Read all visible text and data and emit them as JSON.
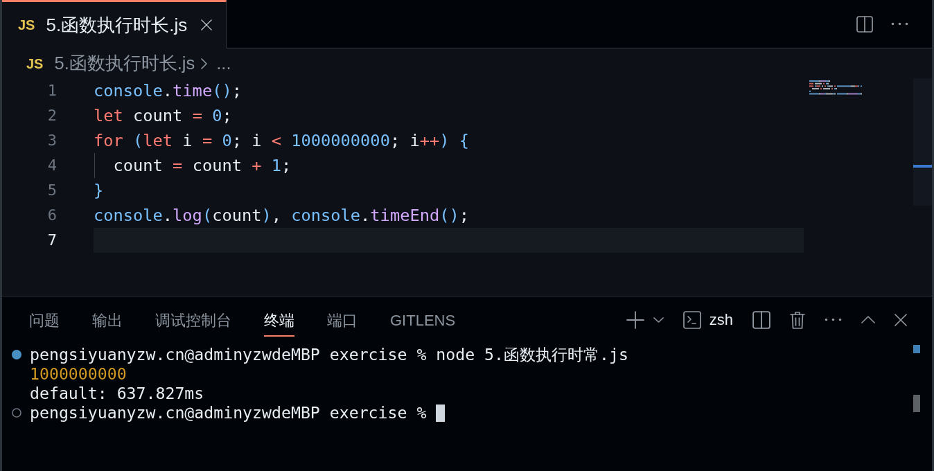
{
  "editor": {
    "tabs": [
      {
        "file_type": "JS",
        "label": "5.函数执行时长.js",
        "selected": true
      }
    ],
    "breadcrumb": [
      {
        "file_type": "JS",
        "label": "5.函数执行时长.js"
      },
      {
        "label": "..."
      }
    ],
    "lines": [
      {
        "number": "1",
        "active": false,
        "indent_guide": false,
        "tokens": [
          {
            "text": "console",
            "kind": "object"
          },
          {
            "text": ".",
            "kind": "plain"
          },
          {
            "text": "time",
            "kind": "method"
          },
          {
            "text": "()",
            "kind": "bracket"
          },
          {
            "text": ";",
            "kind": "plain"
          }
        ]
      },
      {
        "number": "2",
        "active": false,
        "indent_guide": false,
        "tokens": [
          {
            "text": "let",
            "kind": "keyword"
          },
          {
            "text": " count ",
            "kind": "plain"
          },
          {
            "text": "= ",
            "kind": "operator"
          },
          {
            "text": "0",
            "kind": "number"
          },
          {
            "text": ";",
            "kind": "plain"
          }
        ]
      },
      {
        "number": "3",
        "active": false,
        "indent_guide": false,
        "tokens": [
          {
            "text": "for ",
            "kind": "keyword"
          },
          {
            "text": "(",
            "kind": "bracket"
          },
          {
            "text": "let",
            "kind": "keyword"
          },
          {
            "text": " i ",
            "kind": "plain"
          },
          {
            "text": "= ",
            "kind": "operator"
          },
          {
            "text": "0",
            "kind": "number"
          },
          {
            "text": "; i ",
            "kind": "plain"
          },
          {
            "text": "< ",
            "kind": "operator"
          },
          {
            "text": "1000000000",
            "kind": "number"
          },
          {
            "text": "; i",
            "kind": "plain"
          },
          {
            "text": "++",
            "kind": "operator"
          },
          {
            "text": ") ",
            "kind": "bracket"
          },
          {
            "text": "{",
            "kind": "bracket"
          }
        ]
      },
      {
        "number": "4",
        "active": false,
        "indent_guide": true,
        "tokens": [
          {
            "text": "  count ",
            "kind": "plain"
          },
          {
            "text": "= ",
            "kind": "operator"
          },
          {
            "text": "count ",
            "kind": "plain"
          },
          {
            "text": "+ ",
            "kind": "operator"
          },
          {
            "text": "1",
            "kind": "number"
          },
          {
            "text": ";",
            "kind": "plain"
          }
        ]
      },
      {
        "number": "5",
        "active": false,
        "indent_guide": false,
        "tokens": [
          {
            "text": "}",
            "kind": "bracket"
          }
        ]
      },
      {
        "number": "6",
        "active": false,
        "indent_guide": false,
        "tokens": [
          {
            "text": "console",
            "kind": "object"
          },
          {
            "text": ".",
            "kind": "plain"
          },
          {
            "text": "log",
            "kind": "method"
          },
          {
            "text": "(",
            "kind": "bracket"
          },
          {
            "text": "count",
            "kind": "plain"
          },
          {
            "text": ")",
            "kind": "bracket"
          },
          {
            "text": ", ",
            "kind": "plain"
          },
          {
            "text": "console",
            "kind": "object"
          },
          {
            "text": ".",
            "kind": "plain"
          },
          {
            "text": "timeEnd",
            "kind": "method"
          },
          {
            "text": "()",
            "kind": "bracket"
          },
          {
            "text": ";",
            "kind": "plain"
          }
        ]
      },
      {
        "number": "7",
        "active": true,
        "indent_guide": false
      }
    ]
  },
  "panel": {
    "tabs": [
      {
        "label": "问题",
        "selected": false
      },
      {
        "label": "输出",
        "selected": false
      },
      {
        "label": "调试控制台",
        "selected": false
      },
      {
        "label": "终端",
        "selected": true
      },
      {
        "label": "端口",
        "selected": false
      },
      {
        "label": "GITLENS",
        "selected": false
      }
    ],
    "terminal_picker": {
      "label": "zsh"
    },
    "terminal": {
      "lines": [
        {
          "kind": "command",
          "text": "pengsiyuanyzw.cn@adminyzwdeMBP exercise % node 5.函数执行时常.js",
          "cursor": false
        },
        {
          "kind": "number",
          "text": "1000000000",
          "cursor": false
        },
        {
          "kind": "output",
          "text": "default: 637.827ms",
          "cursor": false
        },
        {
          "kind": "prompt",
          "text": "pengsiyuanyzw.cn@adminyzwdeMBP exercise %",
          "cursor": true
        }
      ]
    }
  }
}
